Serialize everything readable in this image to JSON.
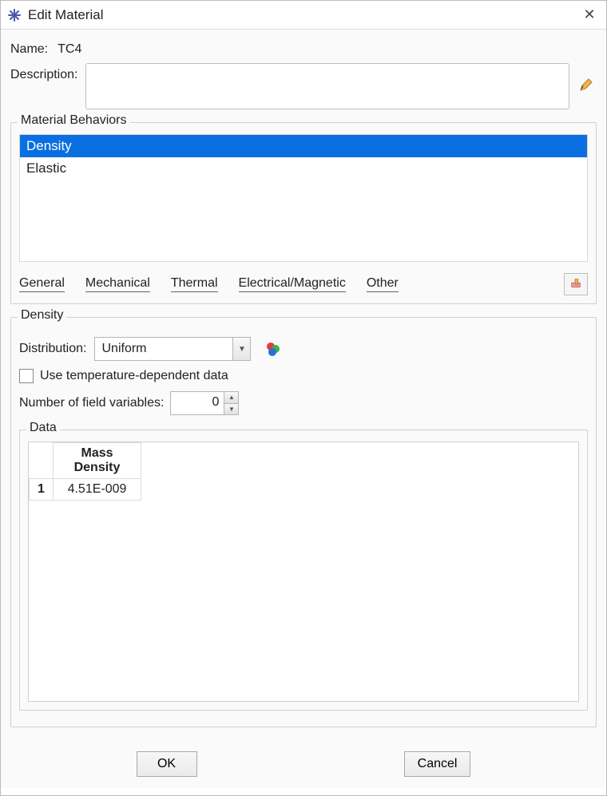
{
  "window": {
    "title": "Edit Material",
    "close_glyph": "✕"
  },
  "fields": {
    "name_label": "Name:",
    "name_value": "TC4",
    "description_label": "Description:",
    "description_value": ""
  },
  "behaviors": {
    "legend": "Material Behaviors",
    "items": [
      "Density",
      "Elastic"
    ],
    "selected_index": 0,
    "menus": {
      "general": "General",
      "mechanical": "Mechanical",
      "thermal": "Thermal",
      "electrical": "Electrical/Magnetic",
      "other": "Other"
    }
  },
  "density": {
    "legend": "Density",
    "distribution_label": "Distribution:",
    "distribution_value": "Uniform",
    "temp_checkbox_label": "Use temperature-dependent data",
    "temp_checked": false,
    "field_vars_label": "Number of field variables:",
    "field_vars_value": "0",
    "data": {
      "legend": "Data",
      "header_line1": "Mass",
      "header_line2": "Density",
      "rows": [
        {
          "index": "1",
          "value": "4.51E-009"
        }
      ]
    }
  },
  "footer": {
    "ok": "OK",
    "cancel": "Cancel"
  }
}
